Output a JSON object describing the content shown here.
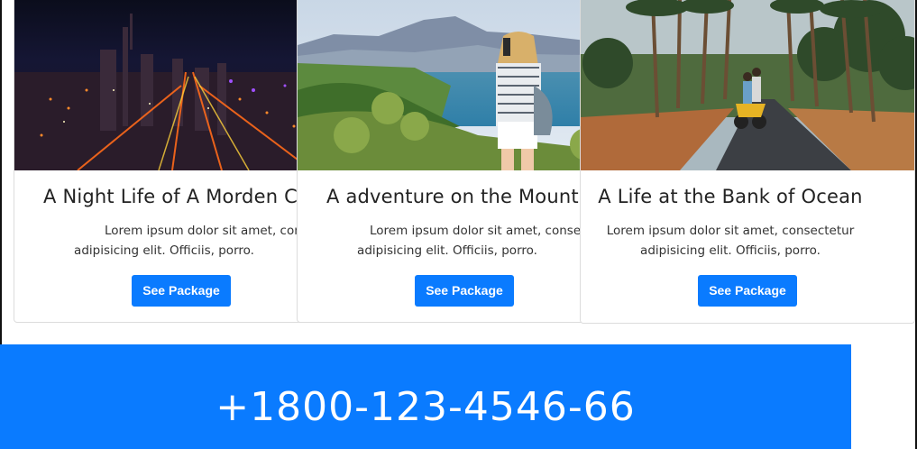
{
  "cards": [
    {
      "title": "A Night Life of A Morden City",
      "text_line1": "Lorem ipsum dolor sit amet, consectetur",
      "text_line2": "adipisicing elit. Officiis, porro.",
      "button_label": "See Package",
      "image": "night-city-photo"
    },
    {
      "title": "A adventure on the Mountains",
      "text_line1": "Lorem ipsum dolor sit amet, consectetur",
      "text_line2": "adipisicing elit. Officiis, porro.",
      "button_label": "See Package",
      "image": "mountain-lake-photo"
    },
    {
      "title": "A Life at the Bank of Ocean",
      "text_line1": "Lorem ipsum dolor sit amet, consectetur",
      "text_line2": "adipisicing elit. Officiis, porro.",
      "button_label": "See Package",
      "image": "palm-road-scooter-photo"
    }
  ],
  "phone_band": {
    "phone_number": "+1800-123-4546-66"
  },
  "colors": {
    "primary": "#0a7bff",
    "text": "#222222"
  }
}
